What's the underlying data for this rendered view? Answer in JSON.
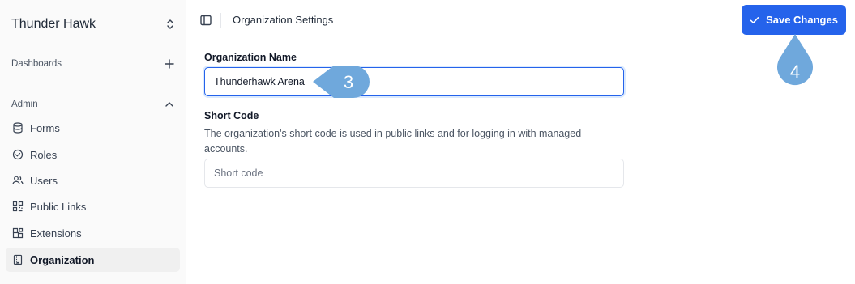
{
  "sidebar": {
    "org_name": "Thunder Hawk",
    "dashboards_label": "Dashboards",
    "admin_label": "Admin",
    "items": [
      {
        "label": "Forms",
        "icon": "database-icon"
      },
      {
        "label": "Roles",
        "icon": "check-circle-icon"
      },
      {
        "label": "Users",
        "icon": "users-icon"
      },
      {
        "label": "Public Links",
        "icon": "qr-code-icon"
      },
      {
        "label": "Extensions",
        "icon": "blocks-icon"
      },
      {
        "label": "Organization",
        "icon": "building-icon",
        "active": true
      }
    ]
  },
  "header": {
    "title": "Organization Settings",
    "save_label": "Save Changes"
  },
  "form": {
    "org_name_label": "Organization Name",
    "org_name_value": "Thunderhawk Arena",
    "short_code_label": "Short Code",
    "short_code_description": "The organization's short code is used in public links and for logging in with managed accounts.",
    "short_code_placeholder": "Short code",
    "short_code_value": ""
  },
  "annotations": {
    "step_3": "3",
    "step_4": "4",
    "color": "#6fa8dc"
  },
  "colors": {
    "accent": "#2563eb",
    "active_bg": "#f0f0f0"
  }
}
